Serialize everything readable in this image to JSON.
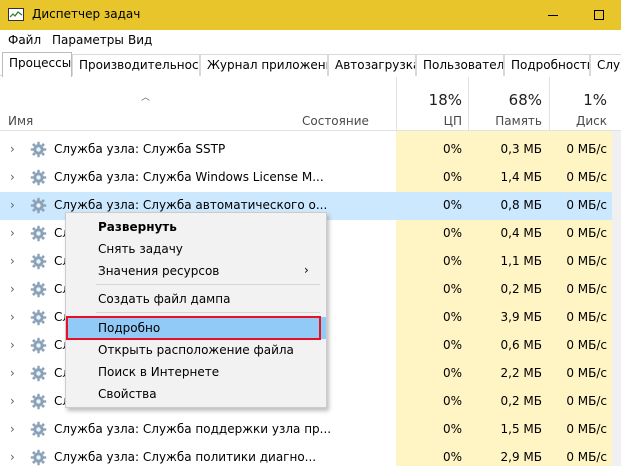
{
  "window": {
    "title": "Диспетчер задач"
  },
  "menu": [
    "Файл",
    "Параметры",
    "Вид"
  ],
  "tabs": [
    "Процессы",
    "Производительность",
    "Журнал приложений",
    "Автозагрузка",
    "Пользователи",
    "Подробности",
    "Служ"
  ],
  "columns": {
    "name": "Имя",
    "state": "Состояние",
    "cpu": {
      "percent": "18%",
      "label": "ЦП"
    },
    "memory": {
      "percent": "68%",
      "label": "Память"
    },
    "disk": {
      "percent": "1%",
      "label": "Диск"
    }
  },
  "rows": [
    {
      "name": "Служба узла: Служба SSTP",
      "cpu": "0%",
      "memory": "0,3 МБ",
      "disk": "0 МБ/с"
    },
    {
      "name": "Служба узла: Служба Windows License M...",
      "cpu": "0%",
      "memory": "1,4 МБ",
      "disk": "0 МБ/с"
    },
    {
      "name": "Служба узла: Служба автоматического о...",
      "cpu": "0%",
      "memory": "0,8 МБ",
      "disk": "0 МБ/с",
      "selected": true
    },
    {
      "name": "Сл",
      "cpu": "0%",
      "memory": "0,4 МБ",
      "disk": "0 МБ/с"
    },
    {
      "name": "Сл",
      "cpu": "0%",
      "memory": "1,1 МБ",
      "disk": "0 МБ/с"
    },
    {
      "name": "Сл",
      "cpu": "0%",
      "memory": "0,2 МБ",
      "disk": "0 МБ/с"
    },
    {
      "name": "Сл",
      "cpu": "0%",
      "memory": "3,9 МБ",
      "disk": "0 МБ/с"
    },
    {
      "name": "Сл",
      "cpu": "0%",
      "memory": "0,6 МБ",
      "disk": "0 МБ/с"
    },
    {
      "name": "Сл",
      "cpu": "0%",
      "memory": "2,2 МБ",
      "disk": "0 МБ/с"
    },
    {
      "name": "Сл",
      "cpu": "0%",
      "memory": "0,2 МБ",
      "disk": "0 МБ/с"
    },
    {
      "name": "Служба узла: Служба поддержки узла пр...",
      "cpu": "0%",
      "memory": "1,5 МБ",
      "disk": "0 МБ/с"
    },
    {
      "name": "Служба узла: Служба политики диагно...",
      "cpu": "0%",
      "memory": "2,9 МБ",
      "disk": "0 МБ/с"
    }
  ],
  "context_menu": {
    "expand": "Развернуть",
    "end_task": "Снять задачу",
    "resource_values": "Значения ресурсов",
    "create_dump": "Создать файл дампа",
    "details": "Подробно",
    "open_location": "Открыть расположение файла",
    "search_online": "Поиск в Интернете",
    "properties": "Свойства"
  }
}
